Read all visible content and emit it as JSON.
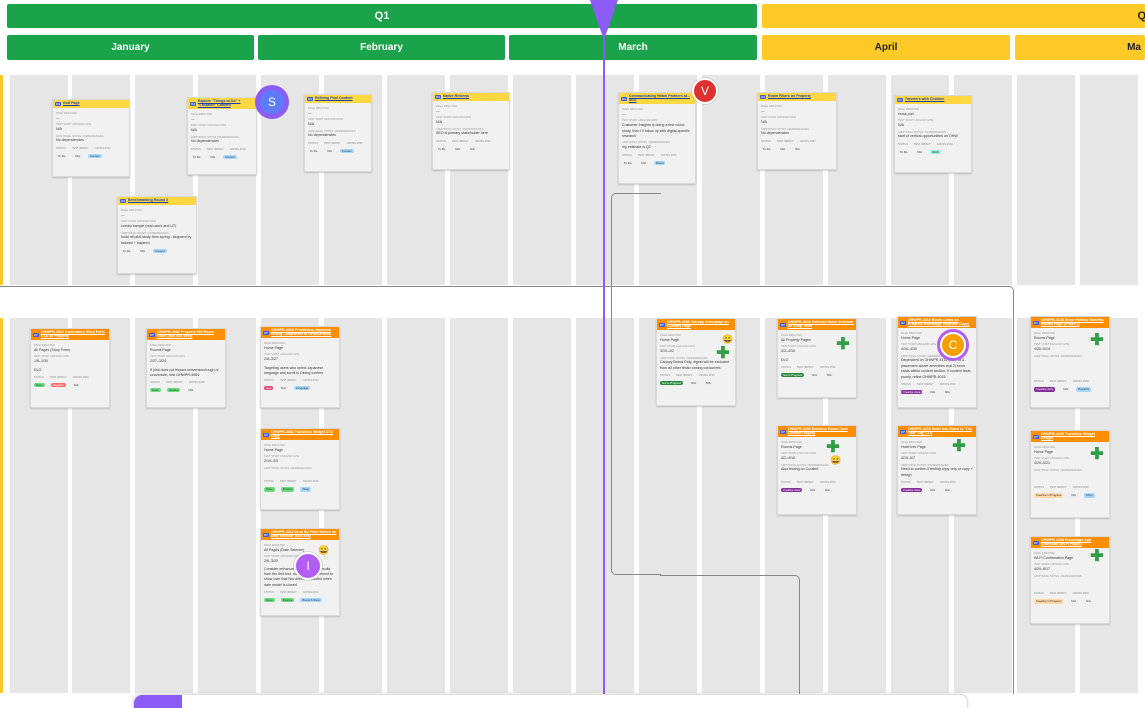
{
  "timeline": {
    "quarters": [
      {
        "label": "Q1"
      },
      {
        "label": "Q"
      }
    ],
    "months": [
      "January",
      "February",
      "March",
      "April",
      "Ma"
    ]
  },
  "colors": {
    "green": "#1aa34a",
    "yellow": "#ffca28",
    "purple": "#8b5cf6",
    "orange": "#ff8f00"
  },
  "avatars": [
    {
      "initial": "S"
    },
    {
      "initial": "V"
    },
    {
      "initial": "C"
    },
    {
      "initial": "I"
    }
  ],
  "cards": {
    "c1": {
      "title": "Golf Page",
      "tag": "C4",
      "l1": "PAGE IMPACTED",
      "v1": "—",
      "l2": "TEST START AND END DATE",
      "v2": "N/A",
      "l3": "ADDITIONAL NOTES / DEPENDENCIES",
      "v3": "No dependencies",
      "status": "To Do",
      "impact": "N/A",
      "cross": "Content"
    },
    "c2": {
      "title": "Explore \"Things to Do\" + \"Location\" Content",
      "tag": "C4",
      "l1": "PAGE IMPACTED",
      "v1": "—",
      "l2": "TEST START AND END DATE",
      "v2": "N/A",
      "l3": "ADDITIONAL NOTES / DEPENDENCIES",
      "v3": "No dependencies",
      "status": "To Do",
      "impact": "N/A",
      "cross": "Content"
    },
    "c3": {
      "title": "Refining Pool Content",
      "tag": "C4",
      "l1": "PAGE IMPACTED",
      "v1": "—",
      "l2": "TEST START AND END DATE",
      "v2": "N/A",
      "l3": "ADDITIONAL NOTES / DEPENDENCIES",
      "v3": "No dependencies",
      "status": "To Do",
      "impact": "N/A",
      "cross": "Content"
    },
    "c4": {
      "title": "Native Reviews",
      "tag": "C4",
      "l1": "PAGE IMPACTED",
      "v1": "—",
      "l2": "TEST START AND END DATE",
      "v2": "N/A",
      "l3": "ADDITIONAL NOTES / DEPENDENCIES",
      "v3": "SEO is primary stakeholder here",
      "status": "To Do",
      "impact": "N/A",
      "cross": "N/A"
    },
    "c5": {
      "title": "Communicating Hilton Partners at... SEO",
      "tag": "C4",
      "l1": "PAGE IMPACTED",
      "v1": "—",
      "l2": "TEST START AND END DATE",
      "v2": "Customer Insights is doing a first round study, then I'll follow up with digital-specific research",
      "l3": "ADDITIONAL NOTES / DEPENDENCIES",
      "v3": "my estimate is Q2",
      "status": "To Do",
      "impact": "N/A",
      "cross": "Brand"
    },
    "c6": {
      "title": "Room Filters on Property",
      "tag": "C4",
      "l1": "PAGE IMPACTED",
      "v1": "—",
      "l2": "TEST START AND END DATE",
      "v2": "N/A",
      "l3": "ADDITIONAL NOTES / DEPENDENCIES",
      "v3": "No dependencies",
      "status": "To Do",
      "impact": "N/A",
      "cross": "N/A"
    },
    "c7": {
      "title": "Travelers with Children",
      "tag": "C4",
      "l1": "PAGE IMPACTED",
      "v1": "cross pod",
      "l2": "TEST START AND END DATE",
      "v2": "N/A",
      "l3": "ADDITIONAL NOTES / DEPENDENCIES",
      "v3": "start of vertical opportunities on OHW",
      "status": "To Do",
      "impact": "N/A",
      "cross": "OHW"
    },
    "c8": {
      "title": "Benchmarking Round 2",
      "tag": "C4",
      "l1": "PAGE IMPACTED",
      "v1": "—",
      "l2": "TEST START AND END DATE",
      "v2": "combo sample (real users and UT)",
      "l3": "ADDITIONAL NOTES / DEPENDENCIES",
      "v3": "build off pilot study from spring - segment by tailored + inspired",
      "status": "To Do",
      "impact": "N/A",
      "cross": "Content"
    },
    "c9": {
      "title": "OHWPR-4014 Exploratory Shop Form CTA on Property",
      "tag": "C7",
      "l1": "PAGE IMPACTED",
      "v1": "All Pages (Shop Form)",
      "l2": "TEST START AND END DATE",
      "v2": "1/9–1/30",
      "l3": "",
      "v3": "DLO",
      "status": "Done",
      "impact": "Negative",
      "cross": "N/A"
    },
    "c10": {
      "title": "OHWPR-4082 Property 360 Room Tours (Nor-Sea Sect)",
      "tag": "C7",
      "l1": "PAGE IMPACTED",
      "v1": "Rooms Page",
      "l2": "TEST START AND END DATE",
      "v2": "2/27–3/24",
      "l3": "",
      "v3": "If pilot does not impact conversion/rough or conversion, test OHWPR-4084",
      "status": "Done",
      "impact": "Positive",
      "cross": "N/A"
    },
    "c11": {
      "title": "OHWPR-4018 Prioritizing Japanese Dining Component in OHW/LP/MSE",
      "tag": "C7",
      "l1": "PAGE IMPACTED",
      "v1": "Home Page",
      "l2": "TEST START AND END DATE",
      "v2": "2/8–3/27",
      "l3": "",
      "v3": "Targeting users who select Japanese language and scroll to Dining content",
      "status": "Live",
      "impact": "N/A",
      "cross": "Language"
    },
    "c12": {
      "title": "OHWPR-4082 Transition Widget CTA Copy",
      "tag": "C7",
      "l1": "PAGE IMPACTED",
      "v1": "Home Page",
      "l2": "TEST START AND END DATE",
      "v2": "2/10–3/3",
      "l3": "ADDITIONAL NOTES / DEPENDENCIES",
      "v3": "",
      "status": "Done",
      "impact": "Positive",
      "cross": "Shop"
    },
    "c13": {
      "title": "OHWPR-4112 Drop By Price Button on Date Selector (Nor-Sea)",
      "tag": "C7",
      "l1": "PAGE IMPACTED",
      "v1": "All Pages (Date Selector)",
      "l2": "TEST START AND END DATE",
      "v2": "2/6–3/20",
      "l3": "",
      "v3": "Consider enhancements based on results from the first test, consider enhancement to show user that Nor defies a selected when date model is closed",
      "status": "Done",
      "impact": "Positive",
      "cross": "Brand & Shop"
    },
    "c14": {
      "title": "OHWPR-4089 Canopy Homepage on Culinary Page",
      "tag": "C7",
      "l1": "PAGE IMPACTED",
      "v1": "Home Page",
      "l2": "TEST START AND END DATE",
      "v2": "3/19–4/2",
      "l3": "ADDITIONAL NOTES / DEPENDENCIES",
      "v3": "Canopy Brand Only, digest will be excluded from all other tests running concurrent",
      "status": "Not in Progress",
      "impact": "N/A",
      "cross": "N/A"
    },
    "c15": {
      "title": "OHWPR-4016 Selected Dates Indicator on Shop Form",
      "tag": "C7",
      "l1": "PAGE IMPACTED",
      "v1": "All Property Pages",
      "l2": "TEST START AND END DATE",
      "v2": "4/3–4/16",
      "l3": "",
      "v3": "DLO",
      "status": "Not in Progress",
      "impact": "N/A",
      "cross": "N/A"
    },
    "c16": {
      "title": "OHWPR-4015 Room Cards on Property Homepage (Improve Copy)",
      "tag": "C7",
      "l1": "PAGE IMPACTED",
      "v1": "Home Page",
      "l2": "TEST START AND END DATE",
      "v2": "4/16–4/30",
      "l3": "ADDITIONAL NOTES / DEPENDENCIES",
      "v3": "Dependent on OHWPR-4114 (MVT of 3 placement above amenities and 2) room cards within content section. If content tests poorly, refine OHWPR-4015",
      "status": "Creative done",
      "impact": "N/A",
      "cross": "N/A"
    },
    "c17": {
      "title": "OHWPR-4128 Show Holiday Benefits Rooms Page (Phase 2)",
      "tag": "C7",
      "l1": "PAGE IMPACTED",
      "v1": "Rooms Page",
      "l2": "TEST START AND END DATE",
      "v2": "4/25–5/14",
      "l3": "ADDITIONAL NOTES / DEPENDENCIES",
      "v3": "",
      "status": "Creative done",
      "impact": "N/A",
      "cross": "Rewards"
    },
    "c18": {
      "title": "OHWPR-4250 Entrance Room Card Content Display",
      "tag": "C7",
      "l1": "PAGE IMPACTED",
      "v1": "Rooms Page",
      "l2": "TEST START AND END DATE",
      "v2": "4/2–4/18",
      "l3": "ADDITIONAL NOTES / DEPENDENCIES",
      "v3": "Also testing on Curated",
      "status": "Creative done",
      "impact": "N/A",
      "cross": "N/A"
    },
    "c19": {
      "title": "OHWPR-4218 Hotel Info Rates to 'The Tour' Day CTA",
      "tag": "C7",
      "l1": "PAGE IMPACTED",
      "v1": "Hotel Info Page",
      "l2": "TEST START AND END DATE",
      "v2": "4/19–5/7",
      "l3": "ADDITIONAL NOTES / DEPENDENCIES",
      "v3": "Need to confirm if testing copy only or copy + design",
      "status": "Creative done",
      "impact": "N/A",
      "cross": "N/A"
    },
    "c20": {
      "title": "OHWPR-4249 Transition Widget Design",
      "tag": "C7",
      "l1": "PAGE IMPACTED",
      "v1": "Home Page",
      "l2": "TEST START AND END DATE",
      "v2": "4/29–5/21",
      "l3": "ADDITIONAL NOTES / DEPENDENCIES",
      "v3": "",
      "status": "Creative in Progress",
      "impact": "N/A",
      "cross": "Shop"
    },
    "c21": {
      "title": "OHWPR-4308 Encourage App Download (Wi-Fi Pages)",
      "tag": "C7",
      "l1": "PAGE IMPACTED",
      "v1": "Wi-Fi Confirmation Page",
      "l2": "TEST START AND END DATE",
      "v2": "4/29–6/17",
      "l3": "ADDITIONAL NOTES / DEPENDENCIES",
      "v3": "",
      "status": "Creative in Progress",
      "impact": "N/A",
      "cross": "N/A"
    }
  },
  "foot_labels": {
    "status": "STATUS",
    "impact": "TEST IMPACT",
    "cross": "CROSS-POD"
  }
}
